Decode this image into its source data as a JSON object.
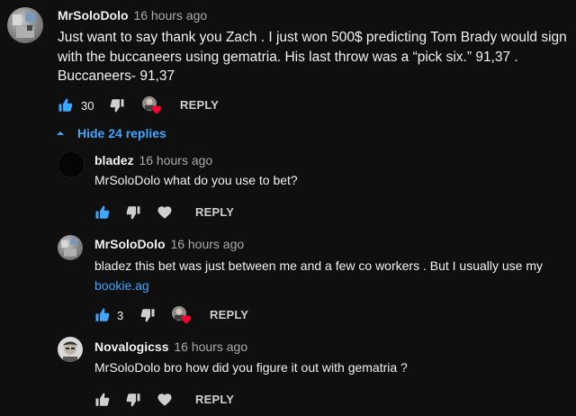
{
  "comment": {
    "author": "MrSoloDolo",
    "time": "16 hours ago",
    "text": "Just want to say thank you Zach . I just won 500$ predicting Tom Brady would sign with the buccaneers using gematria. His last throw was a “pick six.” 91,37 . Buccaneers- 91,37",
    "likes": "30",
    "reply_label": "REPLY"
  },
  "replies_toggle": {
    "label": "Hide 24 replies"
  },
  "replies": [
    {
      "author": "bladez",
      "time": "16 hours ago",
      "text": "MrSoloDolo what do you use to bet?",
      "likes": "",
      "reply_label": "REPLY"
    },
    {
      "author": "MrSoloDolo",
      "time": "16 hours ago",
      "text_before_link": "bladez this bet was just between me and a few co workers . But I usually use my",
      "link": "bookie.ag",
      "likes": "3",
      "reply_label": "REPLY"
    },
    {
      "author": "Novalogicss",
      "time": "16 hours ago",
      "text": "MrSoloDolo bro how did you figure it out with gematria ?",
      "likes": "",
      "reply_label": "REPLY"
    }
  ],
  "colors": {
    "background": "#0f0f0f",
    "link": "#3ea6ff",
    "like_active": "#3ea6ff",
    "heart": "#ff0033"
  }
}
